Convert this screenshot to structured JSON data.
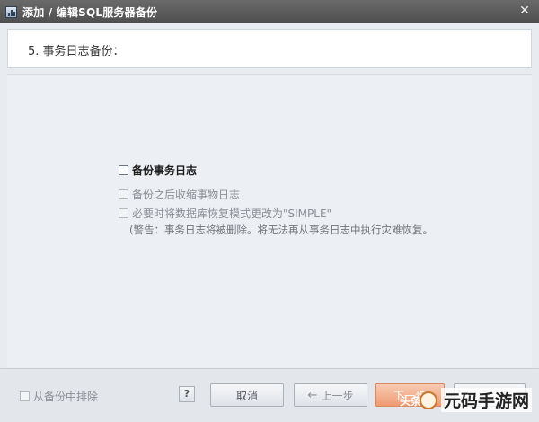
{
  "window": {
    "title": "添加 / 编辑SQL服务器备份",
    "close_glyph": "✕"
  },
  "step": {
    "title": "5. 事务日志备份："
  },
  "options": {
    "backup_log": {
      "label": "备份事务日志",
      "checked": false,
      "enabled": true
    },
    "shrink_after": {
      "label": "备份之后收缩事物日志",
      "checked": false,
      "enabled": false
    },
    "set_simple": {
      "label": "必要时将数据库恢复模式更改为\"SIMPLE\"",
      "checked": false,
      "enabled": false
    },
    "warning": "(警告：事务日志将被删除。将无法再从事务日志中执行灾难恢复。"
  },
  "footer": {
    "exclude_label": "从备份中排除",
    "help_label": "?",
    "cancel_label": "取消",
    "prev_label": "上一步",
    "prev_icon": "←",
    "next_label": "下一步",
    "finish_label": ""
  },
  "watermark": {
    "text": "元码手游网",
    "overlay_text": "头条"
  },
  "colors": {
    "titlebar": "#555555",
    "next_button": "#ef9a72",
    "content_bg": "#eceff3"
  }
}
